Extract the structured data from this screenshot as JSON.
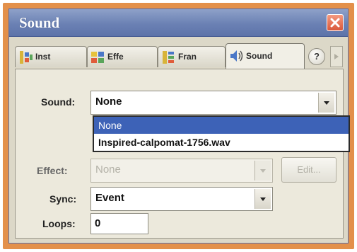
{
  "window": {
    "title": "Sound"
  },
  "tabs": [
    {
      "label": "Inst",
      "icon": "instance-icon"
    },
    {
      "label": "Effe",
      "icon": "effect-icon"
    },
    {
      "label": "Fran",
      "icon": "frame-icon"
    },
    {
      "label": "Sound",
      "icon": "sound-icon",
      "active": true
    }
  ],
  "help_label": "?",
  "sound": {
    "label": "Sound:",
    "value": "None",
    "options": [
      "None",
      "Inspired-calpomat-1756.wav"
    ]
  },
  "effect": {
    "label": "Effect:",
    "value": "None",
    "edit_label": "Edit..."
  },
  "sync": {
    "label": "Sync:",
    "value": "Event"
  },
  "loops": {
    "label": "Loops:",
    "value": "0"
  },
  "colors": {
    "title_bar": "#6b81b4",
    "highlight": "#3d62b7",
    "frame": "#e3904a"
  }
}
